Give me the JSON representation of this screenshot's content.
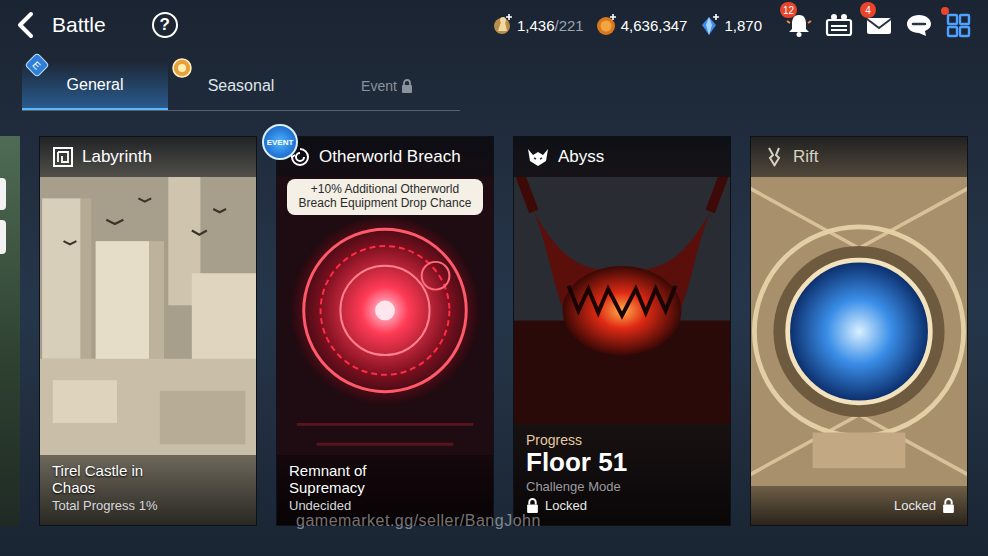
{
  "header": {
    "title": "Battle",
    "help": "?"
  },
  "resources": [
    {
      "kind": "stamina",
      "value": "1,436",
      "max": "/221"
    },
    {
      "kind": "gold",
      "value": "4,636,347"
    },
    {
      "kind": "crystal",
      "value": "1,870"
    }
  ],
  "menu_icons": [
    {
      "kind": "bell",
      "badge": "12",
      "dot": false
    },
    {
      "kind": "party",
      "dot": false
    },
    {
      "kind": "mail",
      "badge": "4",
      "dot": false
    },
    {
      "kind": "chat",
      "dot": false
    },
    {
      "kind": "grid",
      "dot": true
    }
  ],
  "tabs": [
    {
      "label": "General",
      "selected": true,
      "locked": false,
      "badge": "E"
    },
    {
      "label": "Seasonal",
      "selected": false,
      "locked": false
    },
    {
      "label": "Event",
      "selected": false,
      "locked": true
    }
  ],
  "cards": [
    {
      "kind": "labyrinth",
      "title": "Labyrinth",
      "name": "Tirel Castle in Chaos",
      "detail": "Total Progress 1%",
      "locked": false
    },
    {
      "kind": "breach",
      "title": "Otherworld Breach",
      "event_badge": "EVENT",
      "tooltip": "+10% Additional Otherworld Breach Equipment Drop Chance",
      "name": "Remnant of Supremacy",
      "detail": "Undecided",
      "locked": false
    },
    {
      "kind": "abyss",
      "title": "Abyss",
      "progress_label": "Progress",
      "progress": "Floor 51",
      "detail": "Challenge Mode",
      "locked": true,
      "lock_label": "Locked"
    },
    {
      "kind": "rift",
      "title": "Rift",
      "locked": true,
      "lock_label": "Locked"
    }
  ],
  "watermark": "gamemarket.gg/seller/BangJohn"
}
